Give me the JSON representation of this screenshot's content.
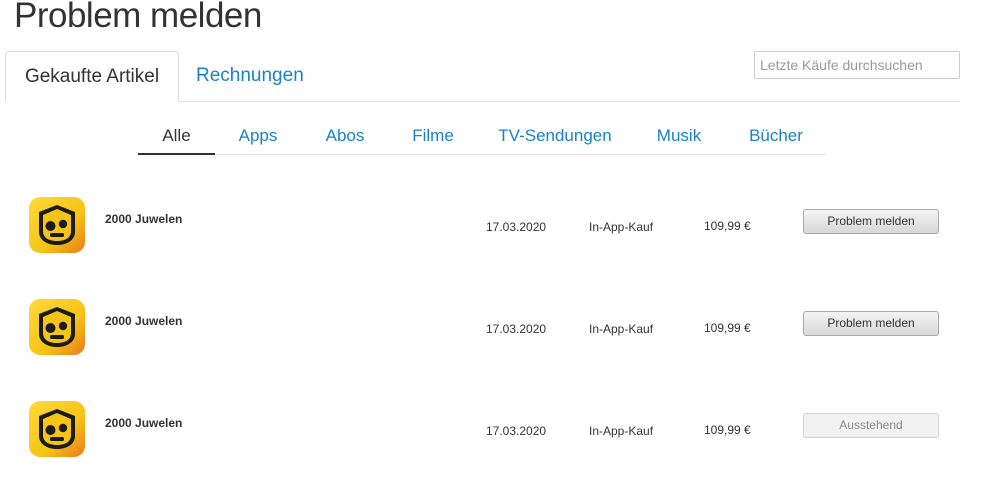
{
  "page": {
    "title": "Problem melden"
  },
  "main_tabs": [
    {
      "label": "Gekaufte Artikel",
      "active": true
    },
    {
      "label": "Rechnungen",
      "active": false
    }
  ],
  "search": {
    "placeholder": "Letzte Käufe durchsuchen",
    "value": ""
  },
  "filters": [
    {
      "label": "Alle",
      "active": true
    },
    {
      "label": "Apps",
      "active": false
    },
    {
      "label": "Abos",
      "active": false
    },
    {
      "label": "Filme",
      "active": false
    },
    {
      "label": "TV-Sendungen",
      "active": false
    },
    {
      "label": "Musik",
      "active": false
    },
    {
      "label": "Bücher",
      "active": false
    }
  ],
  "purchases": [
    {
      "name": "2000 Juwelen",
      "date": "17.03.2020",
      "type": "In-App-Kauf",
      "price": "109,99 €",
      "action": "Problem melden",
      "action_enabled": true,
      "icon": "brawl-stars-skull-icon"
    },
    {
      "name": "2000 Juwelen",
      "date": "17.03.2020",
      "type": "In-App-Kauf",
      "price": "109,99 €",
      "action": "Problem melden",
      "action_enabled": true,
      "icon": "brawl-stars-skull-icon"
    },
    {
      "name": "2000 Juwelen",
      "date": "17.03.2020",
      "type": "In-App-Kauf",
      "price": "109,99 €",
      "action": "Ausstehend",
      "action_enabled": false,
      "icon": "brawl-stars-skull-icon"
    }
  ],
  "colors": {
    "link": "#1a82c4",
    "text": "#333333",
    "icon_yellow": "#f6c417",
    "icon_orange": "#ec7a1c",
    "icon_dark": "#1b1b1b"
  }
}
